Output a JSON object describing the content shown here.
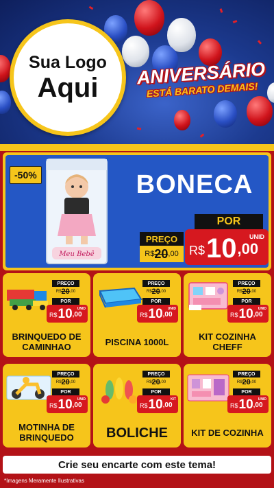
{
  "header": {
    "logo_line1": "Sua Logo",
    "logo_line2": "Aqui",
    "title_line1": "ANIVERSÁRIO",
    "title_line2": "ESTÁ BARATO DEMAIS!"
  },
  "featured": {
    "discount": "-50%",
    "name": "BONECA",
    "preco_label": "PREÇO",
    "old_currency": "R$",
    "old_price": "20",
    "old_cents": ",00",
    "por_label": "POR",
    "unit": "UNID",
    "currency": "R$",
    "price": "10",
    "cents": ",00",
    "image_icon": "doll-box-icon"
  },
  "products": [
    {
      "name": "BRINQUEDO DE CAMINHAO",
      "preco_label": "PREÇO",
      "old_currency": "R$",
      "old_price": "20",
      "old_cents": ",00",
      "por_label": "POR",
      "currency": "R$",
      "price": "10",
      "cents": ",00",
      "unit": "UNID",
      "icon": "toy-truck-icon"
    },
    {
      "name": "PISCINA 1000L",
      "preco_label": "PREÇO",
      "old_currency": "R$",
      "old_price": "20",
      "old_cents": ",00",
      "por_label": "POR",
      "currency": "R$",
      "price": "10",
      "cents": ",00",
      "unit": "UNID",
      "icon": "pool-icon"
    },
    {
      "name": "KIT COZINHA CHEFF",
      "preco_label": "PREÇO",
      "old_currency": "R$",
      "old_price": "20",
      "old_cents": ",00",
      "por_label": "POR",
      "currency": "R$",
      "price": "10",
      "cents": ",00",
      "unit": "UNID",
      "icon": "kitchen-kit-icon"
    },
    {
      "name": "MOTINHA DE BRINQUEDO",
      "preco_label": "PREÇO",
      "old_currency": "R$",
      "old_price": "20",
      "old_cents": ",00",
      "por_label": "POR",
      "currency": "R$",
      "price": "10",
      "cents": ",00",
      "unit": "UNID",
      "icon": "toy-motorcycle-icon"
    },
    {
      "name": "BOLICHE",
      "preco_label": "PREÇO",
      "old_currency": "R$",
      "old_price": "20",
      "old_cents": ",00",
      "por_label": "POR",
      "currency": "R$",
      "price": "10",
      "cents": ",00",
      "unit": "KIT",
      "icon": "bowling-icon"
    },
    {
      "name": "KIT DE COZINHA",
      "preco_label": "PREÇO",
      "old_currency": "R$",
      "old_price": "20",
      "old_cents": ",00",
      "por_label": "POR",
      "currency": "R$",
      "price": "10",
      "cents": ",00",
      "unit": "UNID",
      "icon": "kitchen-set-icon"
    }
  ],
  "footer": {
    "cta": "Crie seu encarte com este tema!",
    "disclaimer": "*Imagens Meramente Ilustrativas"
  },
  "colors": {
    "brand_yellow": "#f6c51b",
    "brand_red": "#d6181f",
    "brand_blue": "#2457c5"
  }
}
